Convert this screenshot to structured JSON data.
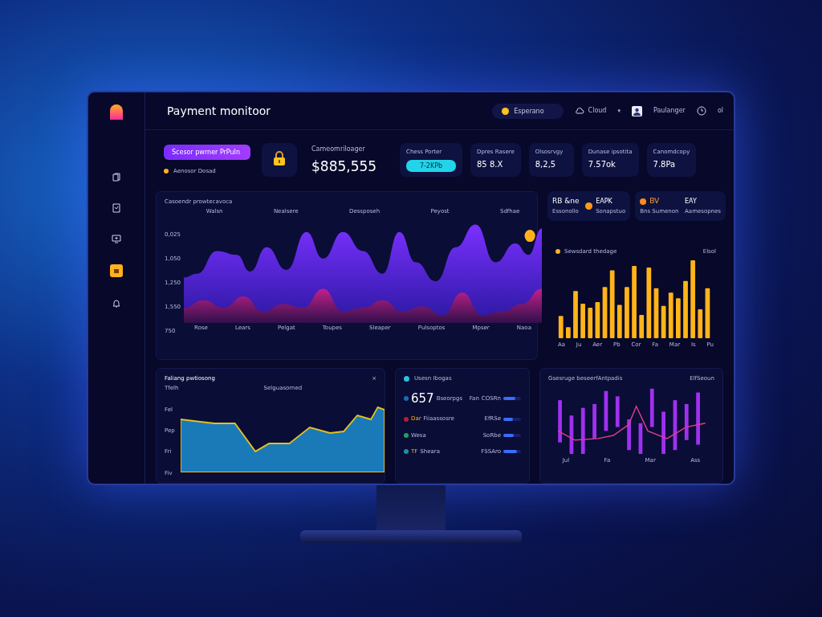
{
  "app": {
    "title": "Payment monitoor"
  },
  "header": {
    "currency": "Esperano",
    "cloud": "Cloud",
    "caret": "▾",
    "user": "Paulanger",
    "extra": "ol"
  },
  "summary": {
    "action": "Scesor pwrner PrPuIn",
    "status": "Aenosor Dosad",
    "balance_label": "Cameomriloager",
    "balance": "$885,555"
  },
  "kpis": [
    {
      "label": "Chess Porter",
      "value": "7-2KPb",
      "kind": "pill"
    },
    {
      "label": "Dpres Rasere",
      "value": "85 8.X",
      "kind": "plain"
    },
    {
      "label": "Olsosrvgy",
      "value": "8,2,5",
      "kind": "plain"
    },
    {
      "label": "Dunase ipsotita",
      "value": "7.57ok",
      "kind": "plain"
    },
    {
      "label": "Canomdcopy",
      "value": "7.8Pa",
      "kind": "plain"
    }
  ],
  "main_chart": {
    "title": "Casoendr prowtecavoca",
    "yticks": [
      "0,025",
      "1,050",
      "1,250",
      "1,550",
      "750"
    ],
    "xticks": [
      "Rose",
      "Lears",
      "Pelgat",
      "Toupes",
      "Sleaper",
      "Pulsoptos",
      "Mpser",
      "Naoa"
    ],
    "notes": [
      "Walsn",
      "Nealsere",
      "Dessposeh",
      "Peyost",
      "Sdfhae"
    ]
  },
  "mini_cards": [
    {
      "title": "RB &ne",
      "subtitle": "Essonollo",
      "value": "EAPK",
      "caption": "Sonapstuo"
    },
    {
      "title": "BV",
      "subtitle": "Bns Sumenon",
      "value": "EAY",
      "caption": "Aamesopnes"
    }
  ],
  "bar_panel": {
    "title": "Sewsdard thedage",
    "legend": "Elsol",
    "xticks": [
      "Aa",
      "Ju",
      "Aer",
      "Pb",
      "Cor",
      "Fa",
      "Mar",
      "Is",
      "Pu"
    ]
  },
  "trend_panel": {
    "title": "Faliang pwtiosong",
    "close": "×",
    "note": "Selguasorned",
    "yticks": [
      "Tfelh",
      "Fel",
      "Pep",
      "Fri",
      "Fiv"
    ]
  },
  "users_panel": {
    "title": "Usesn Ibogas",
    "rows": [
      {
        "name": "Bseorpgs",
        "value": "657",
        "unit": "Fan",
        "count": "COSRn",
        "level": 0.7
      },
      {
        "name": "Fiiaassosre",
        "value": "Dar",
        "unit": "",
        "count": "EfRSe",
        "level": 0.55
      },
      {
        "name": "Wesa",
        "value": "",
        "unit": "",
        "count": "SoRbe",
        "level": 0.6
      },
      {
        "name": "Sheara",
        "value": "TF",
        "unit": "",
        "count": "FSSAro",
        "level": 0.75
      }
    ]
  },
  "mix_panel": {
    "title": "Gsesruge beseerfAntpadis",
    "legend": "ElfSeoun",
    "xticks": [
      "Jul",
      "Fa",
      "Mar",
      "Ass"
    ]
  }
}
